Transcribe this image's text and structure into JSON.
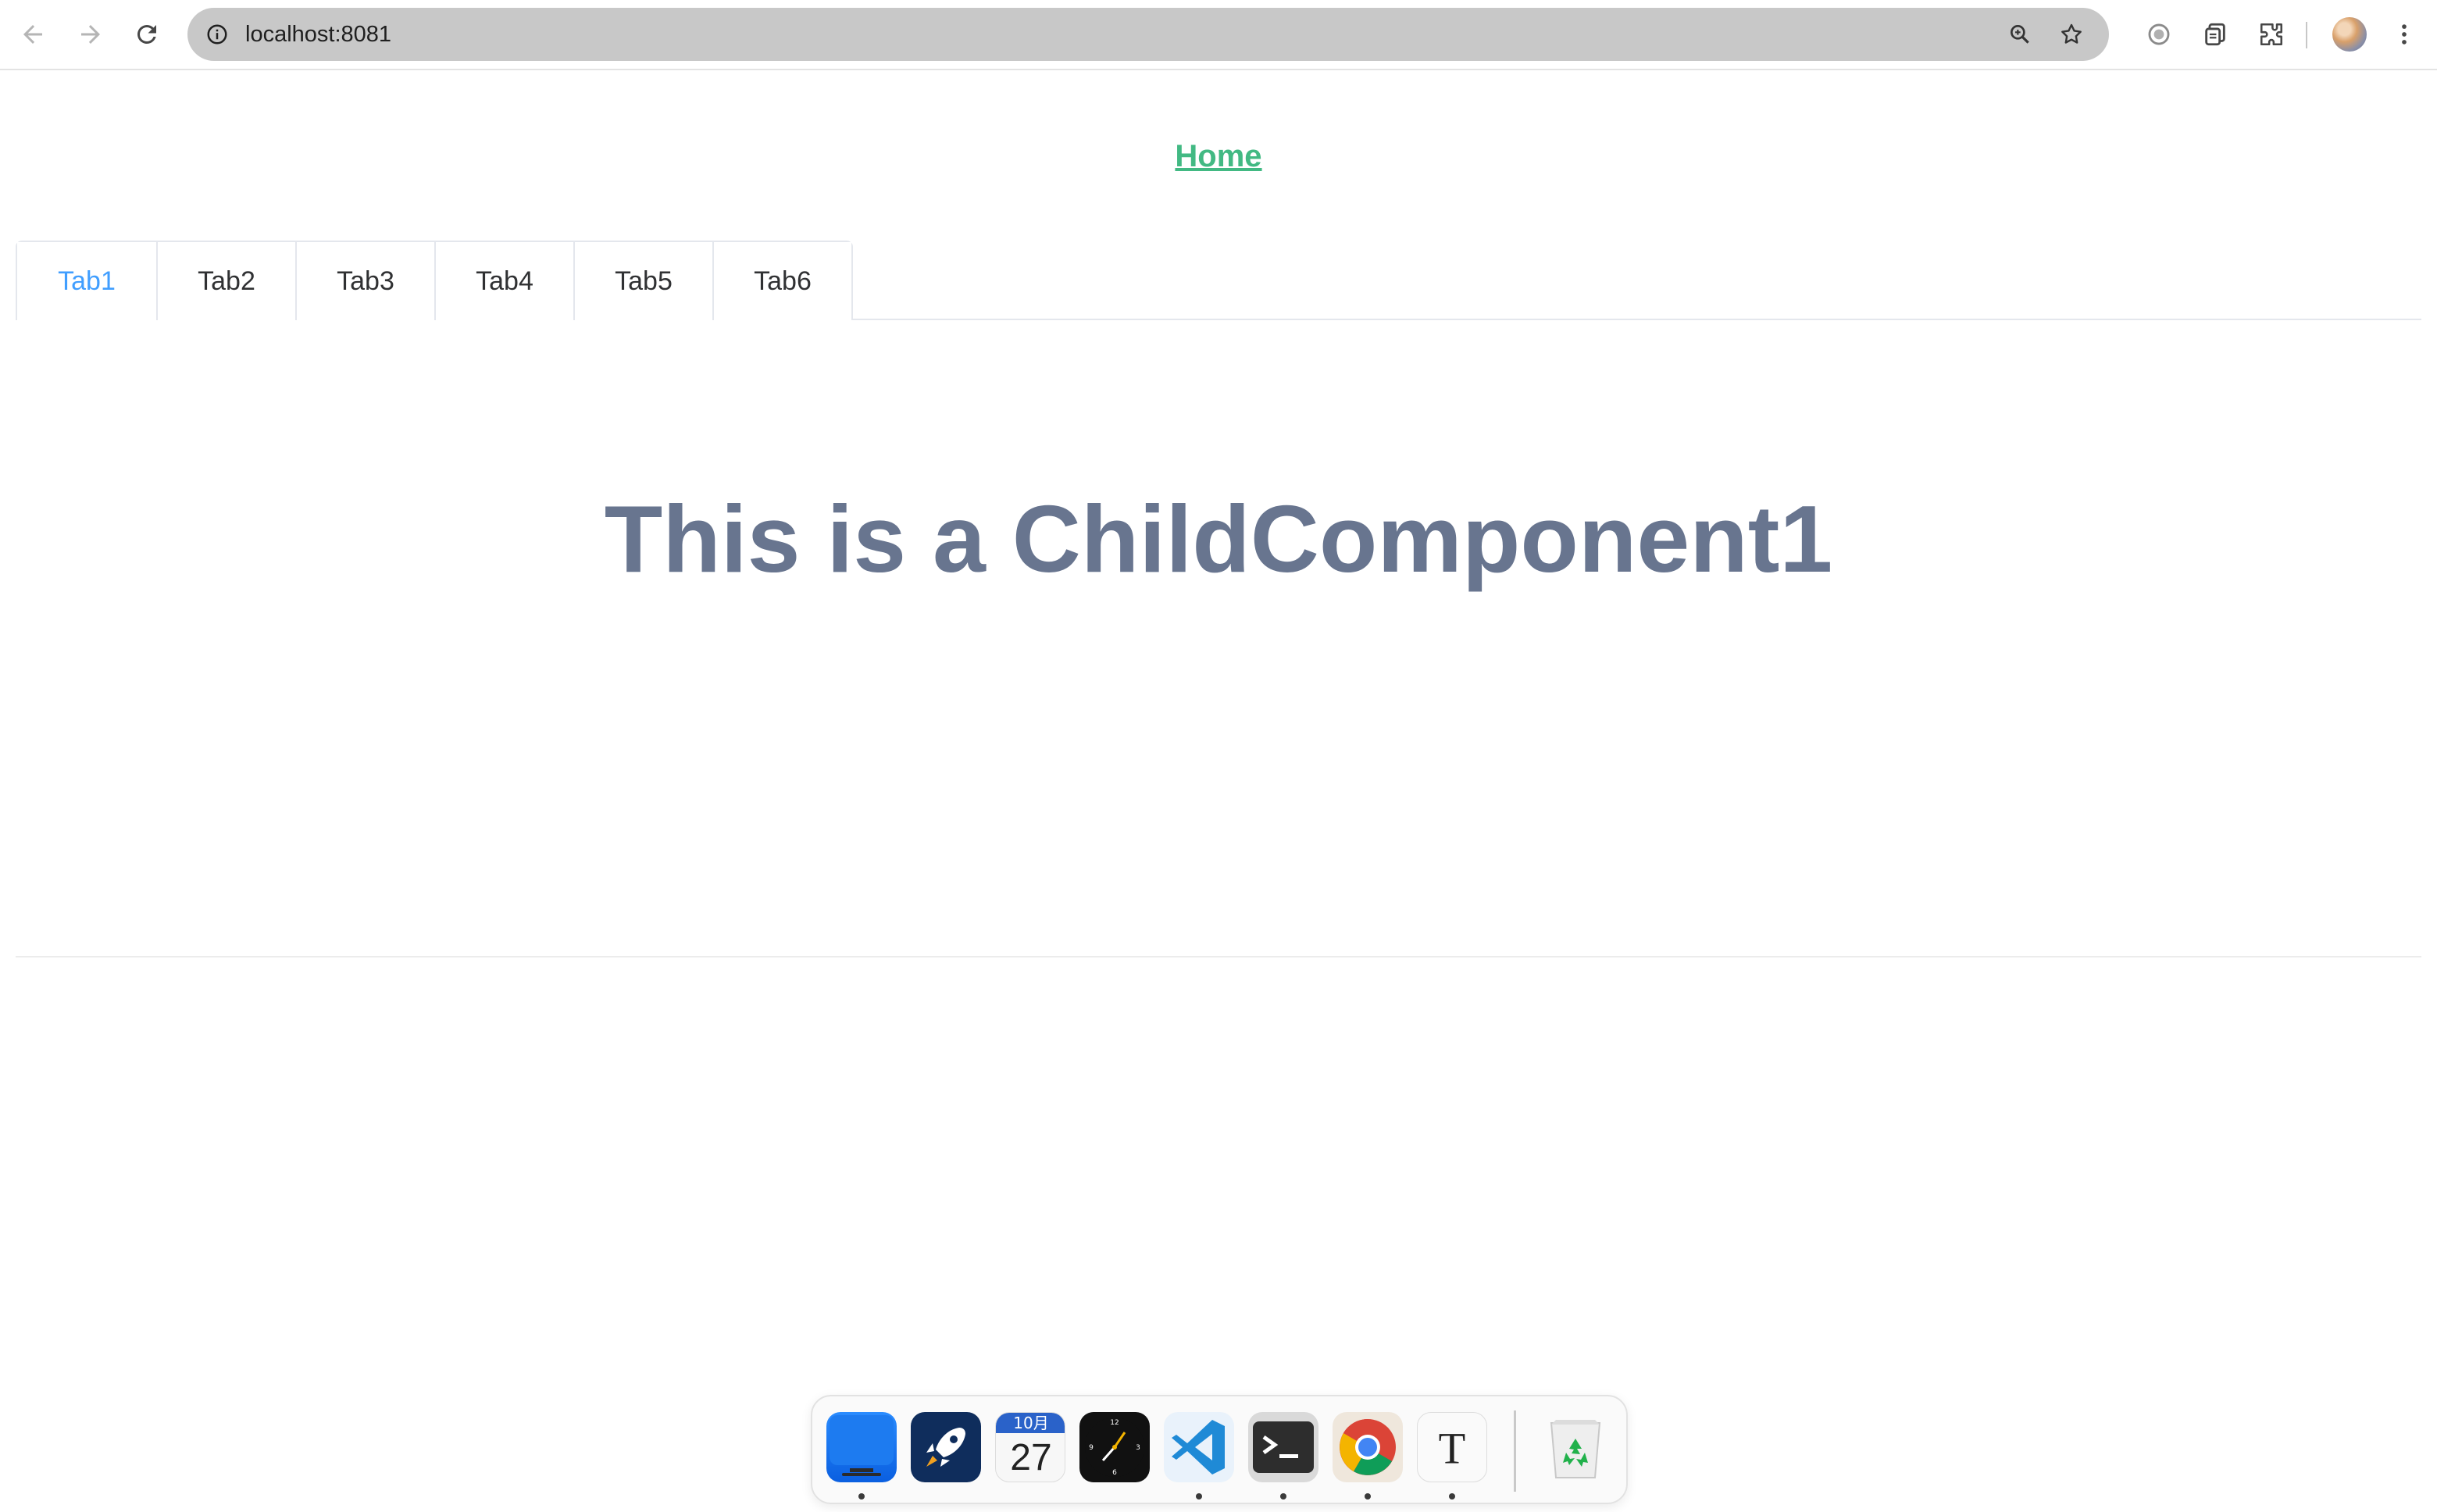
{
  "browser": {
    "url": "localhost:8081",
    "icons": [
      "back-arrow-icon",
      "forward-arrow-icon",
      "reload-icon",
      "site-info-icon",
      "zoom-icon",
      "bookmark-star-icon",
      "record-icon",
      "copy-icon",
      "extensions-icon",
      "profile-avatar",
      "more-menu-icon"
    ]
  },
  "page": {
    "home_link": "Home",
    "tabs": [
      "Tab1",
      "Tab2",
      "Tab3",
      "Tab4",
      "Tab5",
      "Tab6"
    ],
    "active_tab": "Tab1",
    "heading": "This is a ChildComponent1"
  },
  "dock": {
    "apps": [
      "desktop",
      "launchpad",
      "calendar",
      "clock",
      "vscode",
      "terminal",
      "chrome",
      "typora",
      "trash"
    ],
    "calendar": {
      "month": "10月",
      "day": "27"
    }
  },
  "colors": {
    "link": "#42b983",
    "active_tab": "#409eff",
    "heading": "#68758f"
  }
}
